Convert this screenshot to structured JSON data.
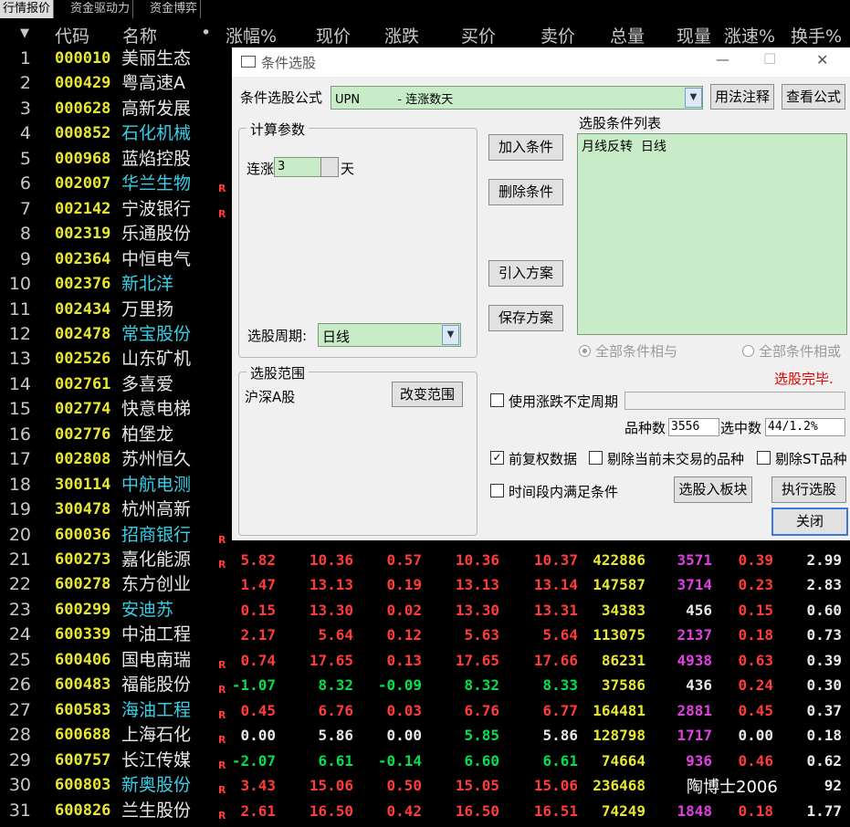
{
  "tabs": [
    "行情报价",
    "资金驱动力",
    "资金博弈"
  ],
  "header": {
    "sort_arrow": "▼",
    "cols": [
      "代码",
      "名称",
      "•",
      "涨幅%",
      "现价",
      "涨跌",
      "买价",
      "卖价",
      "总量",
      "现量",
      "涨速%",
      "换手%"
    ]
  },
  "rows": [
    {
      "n": "1",
      "code": "000010",
      "name": "美丽生态",
      "name_color": "#e8e8e8",
      "r": ""
    },
    {
      "n": "2",
      "code": "000429",
      "name": "粤高速A",
      "name_color": "#e8e8e8",
      "r": ""
    },
    {
      "n": "3",
      "code": "000628",
      "name": "高新发展",
      "name_color": "#e8e8e8",
      "r": ""
    },
    {
      "n": "4",
      "code": "000852",
      "name": "石化机械",
      "name_color": "#38d0e8",
      "r": ""
    },
    {
      "n": "5",
      "code": "000968",
      "name": "蓝焰控股",
      "name_color": "#e8e8e8",
      "r": ""
    },
    {
      "n": "6",
      "code": "002007",
      "name": "华兰生物",
      "name_color": "#38d0e8",
      "r": "R"
    },
    {
      "n": "7",
      "code": "002142",
      "name": "宁波银行",
      "name_color": "#e8e8e8",
      "r": "R"
    },
    {
      "n": "8",
      "code": "002319",
      "name": "乐通股份",
      "name_color": "#e8e8e8",
      "r": ""
    },
    {
      "n": "9",
      "code": "002364",
      "name": "中恒电气",
      "name_color": "#e8e8e8",
      "r": ""
    },
    {
      "n": "10",
      "code": "002376",
      "name": "新北洋",
      "name_color": "#38d0e8",
      "r": ""
    },
    {
      "n": "11",
      "code": "002434",
      "name": "万里扬",
      "name_color": "#e8e8e8",
      "r": ""
    },
    {
      "n": "12",
      "code": "002478",
      "name": "常宝股份",
      "name_color": "#38d0e8",
      "r": ""
    },
    {
      "n": "13",
      "code": "002526",
      "name": "山东矿机",
      "name_color": "#e8e8e8",
      "r": ""
    },
    {
      "n": "14",
      "code": "002761",
      "name": "多喜爱",
      "name_color": "#e8e8e8",
      "r": ""
    },
    {
      "n": "15",
      "code": "002774",
      "name": "快意电梯",
      "name_color": "#e8e8e8",
      "r": ""
    },
    {
      "n": "16",
      "code": "002776",
      "name": "柏堡龙",
      "name_color": "#e8e8e8",
      "r": ""
    },
    {
      "n": "17",
      "code": "002808",
      "name": "苏州恒久",
      "name_color": "#e8e8e8",
      "r": ""
    },
    {
      "n": "18",
      "code": "300114",
      "name": "中航电测",
      "name_color": "#38d0e8",
      "r": ""
    },
    {
      "n": "19",
      "code": "300478",
      "name": "杭州高新",
      "name_color": "#e8e8e8",
      "r": ""
    },
    {
      "n": "20",
      "code": "600036",
      "name": "招商银行",
      "name_color": "#38d0e8",
      "r": "R"
    },
    {
      "n": "21",
      "code": "600273",
      "name": "嘉化能源",
      "name_color": "#e8e8e8",
      "r": "R",
      "vals": [
        [
          "5.82",
          "red"
        ],
        [
          "10.36",
          "red"
        ],
        [
          "0.57",
          "red"
        ],
        [
          "10.36",
          "red"
        ],
        [
          "10.37",
          "red"
        ],
        [
          "422886",
          "yellow"
        ],
        [
          "3571",
          "mag"
        ],
        [
          "0.39",
          "red"
        ],
        [
          "2.99",
          "white"
        ]
      ]
    },
    {
      "n": "22",
      "code": "600278",
      "name": "东方创业",
      "name_color": "#e8e8e8",
      "r": "",
      "vals": [
        [
          "1.47",
          "red"
        ],
        [
          "13.13",
          "red"
        ],
        [
          "0.19",
          "red"
        ],
        [
          "13.13",
          "red"
        ],
        [
          "13.14",
          "red"
        ],
        [
          "147587",
          "yellow"
        ],
        [
          "3714",
          "mag"
        ],
        [
          "0.23",
          "red"
        ],
        [
          "2.83",
          "white"
        ]
      ]
    },
    {
      "n": "23",
      "code": "600299",
      "name": "安迪苏",
      "name_color": "#38d0e8",
      "r": "",
      "vals": [
        [
          "0.15",
          "red"
        ],
        [
          "13.30",
          "red"
        ],
        [
          "0.02",
          "red"
        ],
        [
          "13.30",
          "red"
        ],
        [
          "13.31",
          "red"
        ],
        [
          "34383",
          "yellow"
        ],
        [
          "456",
          "white"
        ],
        [
          "0.15",
          "red"
        ],
        [
          "0.60",
          "white"
        ]
      ]
    },
    {
      "n": "24",
      "code": "600339",
      "name": "中油工程",
      "name_color": "#e8e8e8",
      "r": "",
      "vals": [
        [
          "2.17",
          "red"
        ],
        [
          "5.64",
          "red"
        ],
        [
          "0.12",
          "red"
        ],
        [
          "5.63",
          "red"
        ],
        [
          "5.64",
          "red"
        ],
        [
          "113075",
          "yellow"
        ],
        [
          "2137",
          "mag"
        ],
        [
          "0.18",
          "red"
        ],
        [
          "0.73",
          "white"
        ]
      ]
    },
    {
      "n": "25",
      "code": "600406",
      "name": "国电南瑞",
      "name_color": "#e8e8e8",
      "r": "R",
      "vals": [
        [
          "0.74",
          "red"
        ],
        [
          "17.65",
          "red"
        ],
        [
          "0.13",
          "red"
        ],
        [
          "17.65",
          "red"
        ],
        [
          "17.66",
          "red"
        ],
        [
          "86231",
          "yellow"
        ],
        [
          "4938",
          "mag"
        ],
        [
          "0.63",
          "red"
        ],
        [
          "0.39",
          "white"
        ]
      ]
    },
    {
      "n": "26",
      "code": "600483",
      "name": "福能股份",
      "name_color": "#e8e8e8",
      "r": "R",
      "vals": [
        [
          "-1.07",
          "green"
        ],
        [
          "8.32",
          "green"
        ],
        [
          "-0.09",
          "green"
        ],
        [
          "8.32",
          "green"
        ],
        [
          "8.33",
          "green"
        ],
        [
          "37586",
          "yellow"
        ],
        [
          "436",
          "white"
        ],
        [
          "0.24",
          "red"
        ],
        [
          "0.30",
          "white"
        ]
      ]
    },
    {
      "n": "27",
      "code": "600583",
      "name": "海油工程",
      "name_color": "#38d0e8",
      "r": "R",
      "vals": [
        [
          "0.45",
          "red"
        ],
        [
          "6.76",
          "red"
        ],
        [
          "0.03",
          "red"
        ],
        [
          "6.76",
          "red"
        ],
        [
          "6.77",
          "red"
        ],
        [
          "164481",
          "yellow"
        ],
        [
          "2881",
          "mag"
        ],
        [
          "0.45",
          "red"
        ],
        [
          "0.37",
          "white"
        ]
      ]
    },
    {
      "n": "28",
      "code": "600688",
      "name": "上海石化",
      "name_color": "#e8e8e8",
      "r": "R",
      "vals": [
        [
          "0.00",
          "white"
        ],
        [
          "5.86",
          "white"
        ],
        [
          "0.00",
          "white"
        ],
        [
          "5.85",
          "green"
        ],
        [
          "5.86",
          "white"
        ],
        [
          "128798",
          "yellow"
        ],
        [
          "1717",
          "mag"
        ],
        [
          "0.00",
          "white"
        ],
        [
          "0.18",
          "white"
        ]
      ]
    },
    {
      "n": "29",
      "code": "600757",
      "name": "长江传媒",
      "name_color": "#e8e8e8",
      "r": "R",
      "vals": [
        [
          "-2.07",
          "green"
        ],
        [
          "6.61",
          "green"
        ],
        [
          "-0.14",
          "green"
        ],
        [
          "6.60",
          "green"
        ],
        [
          "6.61",
          "green"
        ],
        [
          "74664",
          "yellow"
        ],
        [
          "936",
          "mag"
        ],
        [
          "0.46",
          "red"
        ],
        [
          "0.62",
          "white"
        ]
      ]
    },
    {
      "n": "30",
      "code": "600803",
      "name": "新奥股份",
      "name_color": "#38d0e8",
      "r": "R",
      "vals": [
        [
          "3.43",
          "red"
        ],
        [
          "15.06",
          "red"
        ],
        [
          "0.50",
          "red"
        ],
        [
          "15.05",
          "red"
        ],
        [
          "15.06",
          "red"
        ],
        [
          "236468",
          "yellow"
        ],
        [
          "",
          "mag"
        ],
        [
          "",
          "red"
        ],
        [
          "92",
          "white"
        ]
      ]
    },
    {
      "n": "31",
      "code": "600826",
      "name": "兰生股份",
      "name_color": "#e8e8e8",
      "r": "R",
      "vals": [
        [
          "2.61",
          "red"
        ],
        [
          "16.50",
          "red"
        ],
        [
          "0.42",
          "red"
        ],
        [
          "16.50",
          "red"
        ],
        [
          "16.51",
          "red"
        ],
        [
          "74249",
          "yellow"
        ],
        [
          "1848",
          "mag"
        ],
        [
          "0.18",
          "red"
        ],
        [
          "1.77",
          "white"
        ]
      ]
    }
  ],
  "dialog": {
    "title": "条件选股",
    "formula_label": "条件选股公式",
    "formula_value": "UPN          - 连涨数天",
    "btn_usage": "用法注释",
    "btn_view_formula": "查看公式",
    "params_group": "计算参数",
    "param_label": "连涨",
    "param_value": "3",
    "param_unit": "天",
    "period_label": "选股周期:",
    "period_value": "日线",
    "btn_add": "加入条件",
    "btn_delete": "删除条件",
    "btn_import": "引入方案",
    "btn_save": "保存方案",
    "list_label": "选股条件列表",
    "list_items": [
      "月线反转  日线"
    ],
    "radio_and": "全部条件相与",
    "radio_or": "全部条件相或",
    "status": "选股完毕.",
    "range_group": "选股范围",
    "range_value": "沪深A股",
    "btn_change_range": "改变范围",
    "chk_variable_period": "使用涨跌不定周期",
    "count_label": "品种数",
    "count_value": "3556",
    "selected_label": "选中数",
    "selected_value": "44/1.2%",
    "chk_forward_adj": "前复权数据",
    "chk_exclude_untraded": "剔除当前未交易的品种",
    "chk_exclude_st": "剔除ST品种",
    "chk_within_period": "时间段内满足条件",
    "btn_to_block": "选股入板块",
    "btn_execute": "执行选股",
    "btn_close": "关闭",
    "check_mark": "✓",
    "win_min": "—",
    "win_max": "☐",
    "win_close": "✕",
    "dropdown_arrow": "▼"
  },
  "watermark": "陶博士2006",
  "colors": {
    "up": "#ff3b3b",
    "down": "#00e050",
    "code": "#e8e832",
    "accent": "#38d0e8",
    "volume_now": "#e040e0",
    "status": "#e00000"
  }
}
